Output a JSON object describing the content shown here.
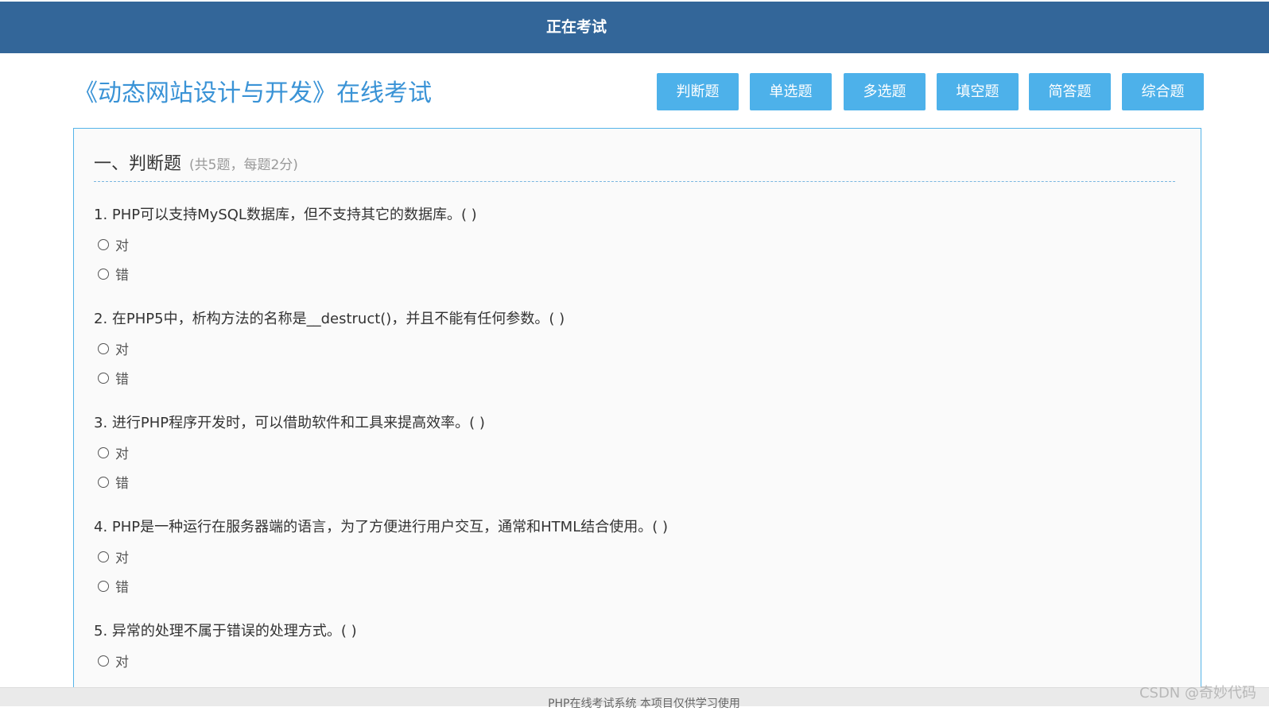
{
  "header": {
    "title": "正在考试"
  },
  "exam_title": "《动态网站设计与开发》在线考试",
  "nav": {
    "items": [
      {
        "label": "判断题"
      },
      {
        "label": "单选题"
      },
      {
        "label": "多选题"
      },
      {
        "label": "填空题"
      },
      {
        "label": "简答题"
      },
      {
        "label": "综合题"
      }
    ]
  },
  "section": {
    "title": "一、判断题",
    "note": "(共5题，每题2分)"
  },
  "questions": [
    {
      "text": "1. PHP可以支持MySQL数据库，但不支持其它的数据库。(    )",
      "options": [
        "对",
        "错"
      ]
    },
    {
      "text": "2. 在PHP5中，析构方法的名称是__destruct()，并且不能有任何参数。(  )",
      "options": [
        "对",
        "错"
      ]
    },
    {
      "text": "3. 进行PHP程序开发时，可以借助软件和工具来提高效率。(    )",
      "options": [
        "对",
        "错"
      ]
    },
    {
      "text": "4. PHP是一种运行在服务器端的语言，为了方便进行用户交互，通常和HTML结合使用。(  )",
      "options": [
        "对",
        "错"
      ]
    },
    {
      "text": "5. 异常的处理不属于错误的处理方式。(  )",
      "options": [
        "对"
      ]
    }
  ],
  "footer": {
    "text": "PHP在线考试系统    本项目仅供学习使用"
  },
  "watermark": "CSDN @奇妙代码"
}
